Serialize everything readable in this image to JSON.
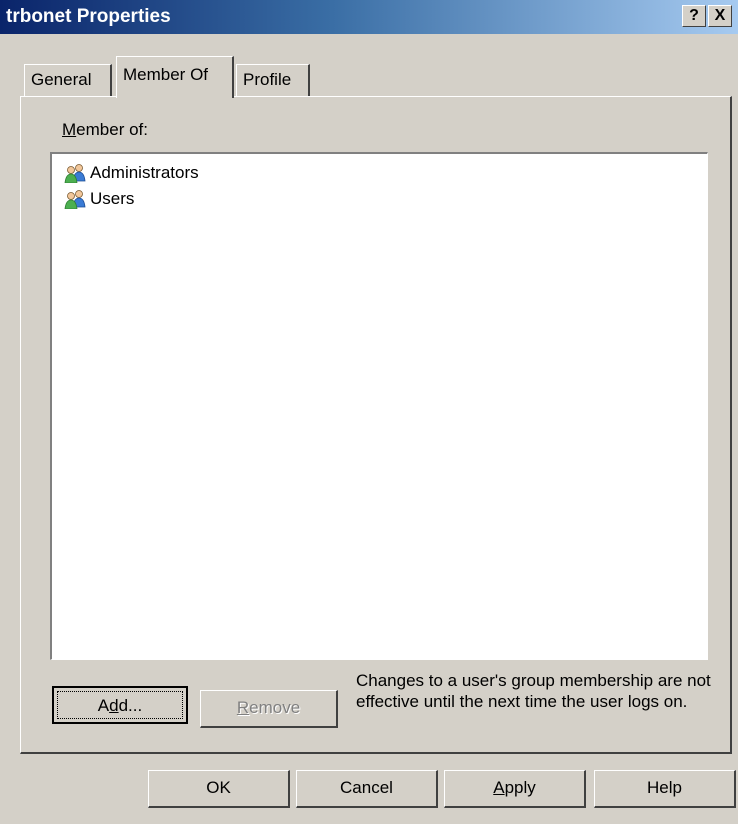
{
  "window": {
    "title": "trbonet Properties",
    "help_glyph": "?",
    "close_glyph": "X"
  },
  "tabs": [
    {
      "label": "General",
      "selected": false
    },
    {
      "label": "Member Of",
      "selected": true
    },
    {
      "label": "Profile",
      "selected": false
    }
  ],
  "member_of": {
    "label_accel": "M",
    "label_rest": "ember of:",
    "items": [
      {
        "label": "Administrators",
        "icon": "user-group-icon"
      },
      {
        "label": "Users",
        "icon": "user-group-icon"
      }
    ]
  },
  "buttons": {
    "add_pre": "A",
    "add_accel": "d",
    "add_post": "d...",
    "remove_accel": "R",
    "remove_rest": "emove",
    "ok": "OK",
    "cancel": "Cancel",
    "apply_accel": "A",
    "apply_rest": "pply",
    "help": "Help"
  },
  "note": "Changes to a user's group membership are not effective until the next time the user logs on.",
  "colors": {
    "title_start": "#0a246a",
    "title_end": "#a6caf0",
    "face": "#d4d0c8"
  }
}
